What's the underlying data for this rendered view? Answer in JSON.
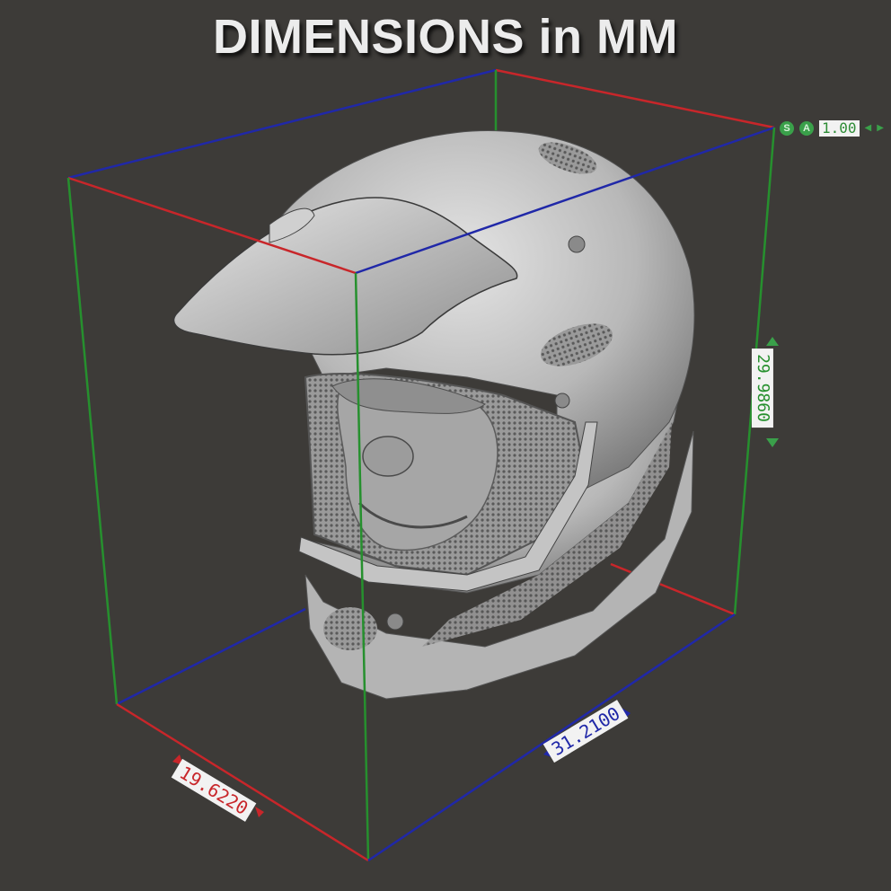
{
  "title": "DIMENSIONS in MM",
  "dimensions": {
    "depth": "19.6220",
    "width": "31.2100",
    "height": "29.9860"
  },
  "scale": {
    "s_label": "S",
    "a_label": "A",
    "value": "1.00"
  },
  "colors": {
    "x_axis": "#c8262a",
    "y_axis": "#2028a8",
    "z_axis": "#26902e",
    "background": "#3d3b38"
  }
}
